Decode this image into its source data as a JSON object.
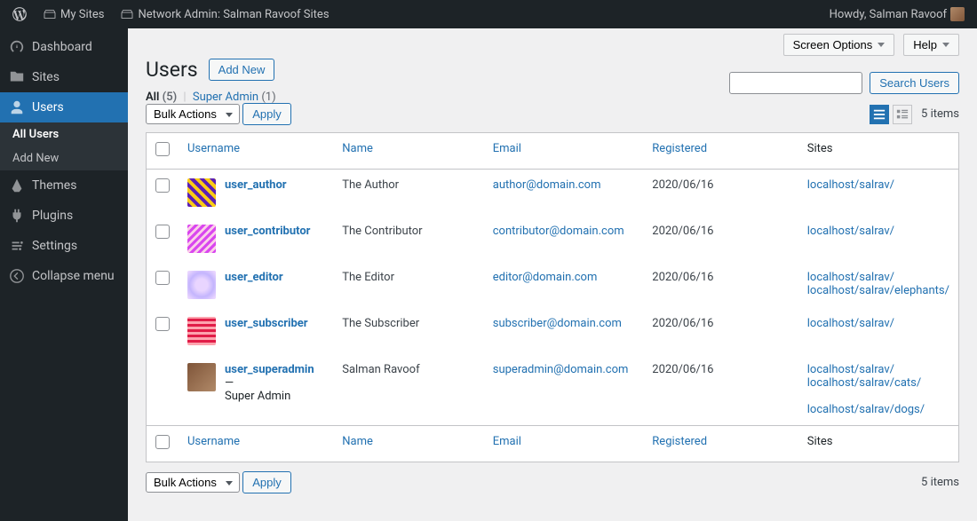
{
  "adminbar": {
    "my_sites": "My Sites",
    "network_admin": "Network Admin: Salman Ravoof Sites",
    "greeting": "Howdy, Salman Ravoof"
  },
  "sidebar": {
    "items": [
      {
        "icon": "dashboard",
        "label": "Dashboard"
      },
      {
        "icon": "sites",
        "label": "Sites"
      },
      {
        "icon": "users",
        "label": "Users",
        "current": true
      },
      {
        "icon": "themes",
        "label": "Themes"
      },
      {
        "icon": "plugins",
        "label": "Plugins"
      },
      {
        "icon": "settings",
        "label": "Settings"
      },
      {
        "icon": "collapse",
        "label": "Collapse menu"
      }
    ],
    "submenu": [
      {
        "label": "All Users",
        "current": true
      },
      {
        "label": "Add New"
      }
    ]
  },
  "topbuttons": {
    "screen_options": "Screen Options",
    "help": "Help"
  },
  "page": {
    "title": "Users",
    "add_new": "Add New"
  },
  "filters": {
    "all": "All",
    "all_count": "(5)",
    "super_admin": "Super Admin",
    "super_admin_count": "(1)"
  },
  "bulk": {
    "label": "Bulk Actions",
    "apply": "Apply"
  },
  "search": {
    "button": "Search Users"
  },
  "items_label": "5 items",
  "columns": {
    "username": "Username",
    "name": "Name",
    "email": "Email",
    "registered": "Registered",
    "sites": "Sites"
  },
  "role_dash": " — ",
  "super_admin_role": "Super Admin",
  "users": [
    {
      "username": "user_author",
      "name": "The Author",
      "email": "author@domain.com",
      "registered": "2020/06/16",
      "sites": [
        "localhost/salrav/"
      ],
      "avatar": "repeating-linear-gradient(45deg,#5b21b6 0 4px,#facc15 4px 8px)"
    },
    {
      "username": "user_contributor",
      "name": "The Contributor",
      "email": "contributor@domain.com",
      "registered": "2020/06/16",
      "sites": [
        "localhost/salrav/"
      ],
      "avatar": "repeating-linear-gradient(135deg,#d946ef 0 3px,#fbcfe8 3px 6px)"
    },
    {
      "username": "user_editor",
      "name": "The Editor",
      "email": "editor@domain.com",
      "registered": "2020/06/16",
      "sites": [
        "localhost/salrav/",
        "localhost/salrav/elephants/"
      ],
      "avatar": "radial-gradient(circle,#e9d5ff 30%,#c4b5fd 60%,#e9d5ff 90%)"
    },
    {
      "username": "user_subscriber",
      "name": "The Subscriber",
      "email": "subscriber@domain.com",
      "registered": "2020/06/16",
      "sites": [
        "localhost/salrav/"
      ],
      "avatar": "repeating-linear-gradient(0deg,#fda4af 0 3px,#e11d48 3px 6px)"
    },
    {
      "username": "user_superadmin",
      "name": "Salman Ravoof",
      "email": "superadmin@domain.com",
      "registered": "2020/06/16",
      "sites": [
        "localhost/salrav/",
        "localhost/salrav/cats/",
        "",
        "localhost/salrav/dogs/"
      ],
      "avatar": "linear-gradient(135deg,#7f5539,#b08968)",
      "is_super": true,
      "no_checkbox": true
    }
  ]
}
